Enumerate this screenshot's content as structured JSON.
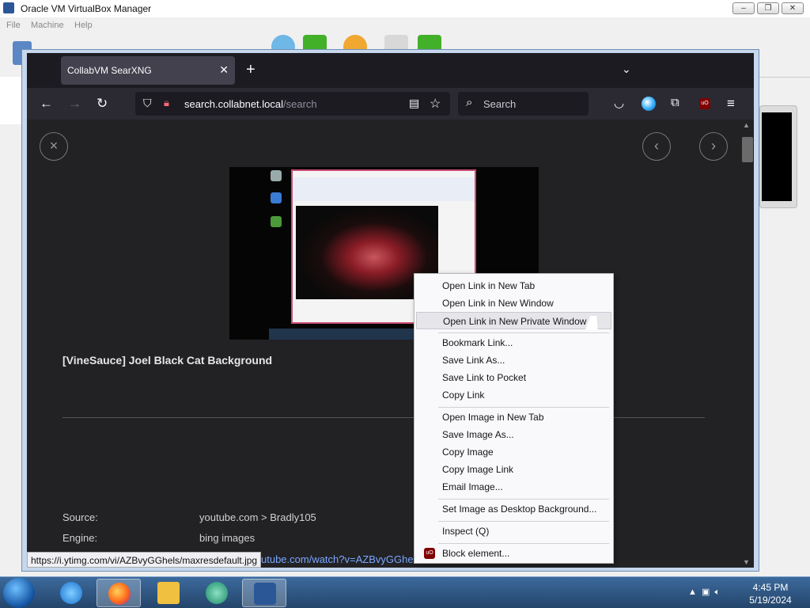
{
  "vbox": {
    "title": "Oracle VM VirtualBox Manager",
    "menu": [
      "File",
      "Machine",
      "Help"
    ],
    "controls": [
      "–",
      "❐",
      "✕"
    ]
  },
  "firefox": {
    "tab_title": "CollabVM SearXNG",
    "tab_close": "✕",
    "new_tab": "+",
    "tab_list": "⌄",
    "window_controls": [
      "–",
      "▭",
      "✕"
    ],
    "url_host": "search.collabnet.local",
    "url_path": "/search",
    "search_placeholder": "Search",
    "nav_icons": [
      "back-icon",
      "forward-icon",
      "reload-icon"
    ]
  },
  "result": {
    "title": "[VineSauce] Joel Black Cat Background",
    "source_label": "Source:",
    "source_value": "youtube.com > Bradly105",
    "engine_label": "Engine:",
    "engine_value": "bing images",
    "link_partial": "utube.com/watch?v=AZBvyGGhel",
    "status_url": "https://i.ytimg.com/vi/AZBvyGGhels/maxresdefault.jpg"
  },
  "context_menu": {
    "items": [
      {
        "label": "Open Link in New Tab",
        "group": 1
      },
      {
        "label": "Open Link in New Window",
        "group": 1
      },
      {
        "label": "Open Link in New Private Window",
        "group": 1,
        "highlighted": true
      },
      {
        "label": "Bookmark Link...",
        "group": 2
      },
      {
        "label": "Save Link As...",
        "group": 2
      },
      {
        "label": "Save Link to Pocket",
        "group": 2
      },
      {
        "label": "Copy Link",
        "group": 2
      },
      {
        "label": "Open Image in New Tab",
        "group": 3
      },
      {
        "label": "Save Image As...",
        "group": 3
      },
      {
        "label": "Copy Image",
        "group": 3
      },
      {
        "label": "Copy Image Link",
        "group": 3
      },
      {
        "label": "Email Image...",
        "group": 3
      },
      {
        "label": "Set Image as Desktop Background...",
        "group": 4
      },
      {
        "label": "Inspect (Q)",
        "group": 5
      },
      {
        "label": "Block element...",
        "group": 6
      }
    ]
  },
  "taskbar": {
    "time": "4:45 PM",
    "date": "5/19/2024",
    "apps": [
      "internet-explorer",
      "firefox",
      "file-explorer",
      "collabvm",
      "virtualbox"
    ]
  },
  "colors": {
    "accent_link": "#7aa7ff",
    "firefox_dark": "#2b2a33",
    "ublock": "#800000"
  }
}
